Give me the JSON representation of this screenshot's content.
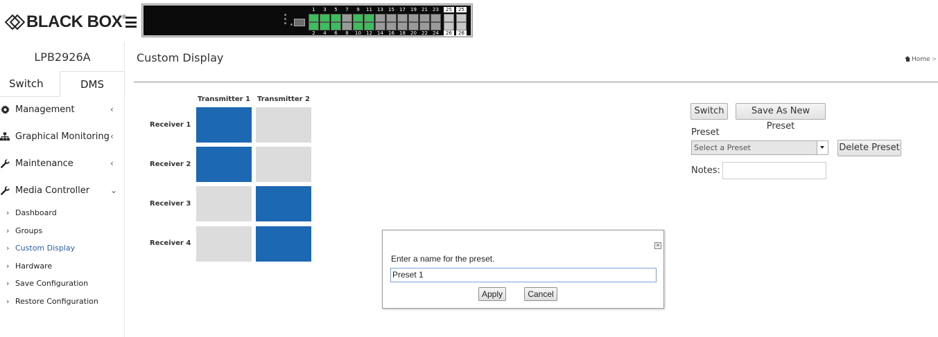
{
  "header": {
    "logo_text": "BLACK BOX",
    "logo_trademark": "®",
    "menu_icon": "hamburger-icon"
  },
  "switch_panel": {
    "top_port_labels": [
      "1",
      "3",
      "5",
      "7",
      "9",
      "11",
      "13",
      "15",
      "17",
      "19",
      "21",
      "23",
      "25",
      "25"
    ],
    "bottom_port_labels": [
      "2",
      "4",
      "6",
      "8",
      "10",
      "12",
      "14",
      "16",
      "18",
      "20",
      "22",
      "24",
      "26",
      "26"
    ],
    "link_up_color": "#3dbd5b",
    "link_down_color": "#9a9a9a"
  },
  "sidebar": {
    "device_name": "LPB2926A",
    "tabs": [
      {
        "label": "Switch"
      },
      {
        "label": "DMS"
      }
    ],
    "active_tab": "DMS",
    "menu": [
      {
        "label": "Management",
        "icon": "gear-icon",
        "chevron": "‹"
      },
      {
        "label": "Graphical Monitoring",
        "icon": "sitemap-icon",
        "chevron": "‹"
      },
      {
        "label": "Maintenance",
        "icon": "wrench-icon",
        "chevron": "‹"
      },
      {
        "label": "Media Controller",
        "icon": "wrench-icon",
        "chevron": "⌄"
      }
    ],
    "submenu_arrow": "›",
    "submenu": [
      {
        "label": "Dashboard"
      },
      {
        "label": "Groups"
      },
      {
        "label": "Custom Display"
      },
      {
        "label": "Hardware"
      },
      {
        "label": "Save Configuration"
      },
      {
        "label": "Restore Configuration"
      }
    ],
    "active_submenu": "Custom Display"
  },
  "main": {
    "title": "Custom Display",
    "breadcrumb": {
      "home_label": "Home",
      "separator": ">"
    },
    "matrix": {
      "columns": [
        "Transmitter 1",
        "Transmitter 2"
      ],
      "rows": [
        "Receiver 1",
        "Receiver 2",
        "Receiver 3",
        "Receiver 4"
      ],
      "assigned_transmitter_per_receiver": [
        1,
        1,
        2,
        2
      ],
      "on_color": "#1c68b3",
      "off_color": "#dcdcdc"
    },
    "controls": {
      "switch_label": "Switch",
      "save_preset_label": "Save As New Preset",
      "preset_label": "Preset",
      "preset_placeholder": "Select a Preset",
      "delete_preset_label": "Delete Preset",
      "notes_label": "Notes:",
      "notes_value": ""
    }
  },
  "dialog": {
    "prompt": "Enter a name for the preset.",
    "input_value": "Preset 1",
    "apply_label": "Apply",
    "cancel_label": "Cancel",
    "close_glyph": "×"
  }
}
